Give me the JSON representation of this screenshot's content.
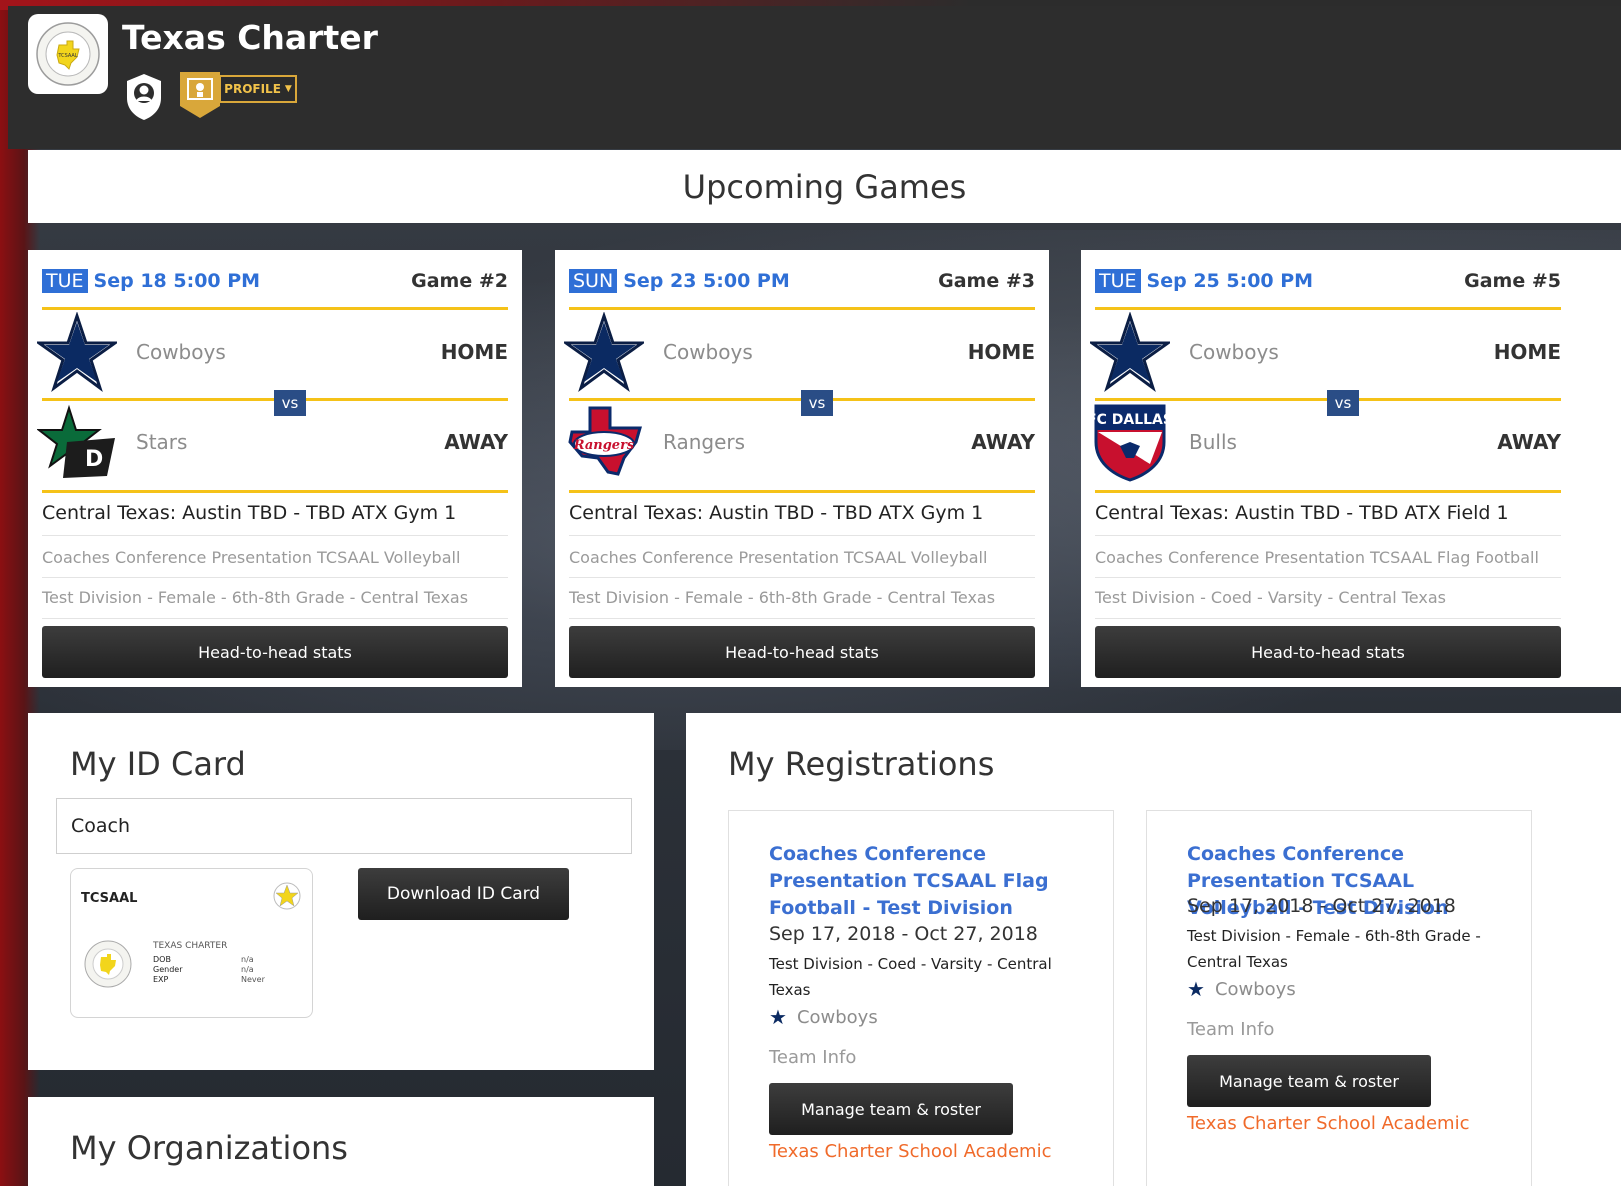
{
  "header": {
    "title": "Texas Charter",
    "profile_label": "PROFILE"
  },
  "upcoming": {
    "title": "Upcoming Games",
    "games": [
      {
        "day": "TUE",
        "date": "Sep 18 5:00 PM",
        "game_no": "Game #2",
        "home_team": "Cowboys",
        "home_label": "HOME",
        "away_team": "Stars",
        "away_label": "AWAY",
        "vs": "vs",
        "venue": "Central Texas: Austin TBD - TBD ATX Gym 1",
        "event": "Coaches Conference Presentation TCSAAL Volleyball",
        "division": "Test Division - Female - 6th-8th Grade - Central Texas",
        "button": "Head-to-head stats"
      },
      {
        "day": "SUN",
        "date": "Sep 23 5:00 PM",
        "game_no": "Game #3",
        "home_team": "Cowboys",
        "home_label": "HOME",
        "away_team": "Rangers",
        "away_label": "AWAY",
        "vs": "vs",
        "venue": "Central Texas: Austin TBD - TBD ATX Gym 1",
        "event": "Coaches Conference Presentation TCSAAL Volleyball",
        "division": "Test Division - Female - 6th-8th Grade - Central Texas",
        "button": "Head-to-head stats"
      },
      {
        "day": "TUE",
        "date": "Sep 25 5:00 PM",
        "game_no": "Game #5",
        "home_team": "Cowboys",
        "home_label": "HOME",
        "away_team": "Bulls",
        "away_label": "AWAY",
        "vs": "vs",
        "venue": "Central Texas: Austin TBD - TBD ATX Field 1",
        "event": "Coaches Conference Presentation TCSAAL Flag Football",
        "division": "Test Division - Coed - Varsity - Central Texas",
        "button": "Head-to-head stats"
      }
    ]
  },
  "id_card": {
    "title": "My ID Card",
    "role": "Coach",
    "card_org": "TCSAAL",
    "card_school": "TEXAS CHARTER",
    "fields": [
      "DOB",
      "Gender",
      "EXP"
    ],
    "values": [
      "n/a",
      "n/a",
      "Never"
    ],
    "download_button": "Download ID Card"
  },
  "organizations": {
    "title": "My Organizations"
  },
  "registrations": {
    "title": "My Registrations",
    "items": [
      {
        "title": "Coaches Conference Presentation TCSAAL Flag Football - Test Division",
        "dates": "Sep 17, 2018 - Oct 27, 2018",
        "division": "Test Division - Coed - Varsity - Central Texas",
        "team": "Cowboys",
        "team_info": "Team Info",
        "button": "Manage team & roster",
        "school": "Texas Charter School Academic"
      },
      {
        "title": "Coaches Conference Presentation TCSAAL Volleyball - Test Division",
        "dates": "Sep 17, 2018 - Oct 27, 2018",
        "division": "Test Division - Female - 6th-8th Grade - Central Texas",
        "team": "Cowboys",
        "team_info": "Team Info",
        "button": "Manage team & roster",
        "school": "Texas Charter School Academic"
      }
    ]
  },
  "colors": {
    "accent_blue": "#2f6fd6",
    "gold": "#f5c218",
    "vs_blue": "#2a4d86",
    "orange_link": "#f06a2a"
  }
}
